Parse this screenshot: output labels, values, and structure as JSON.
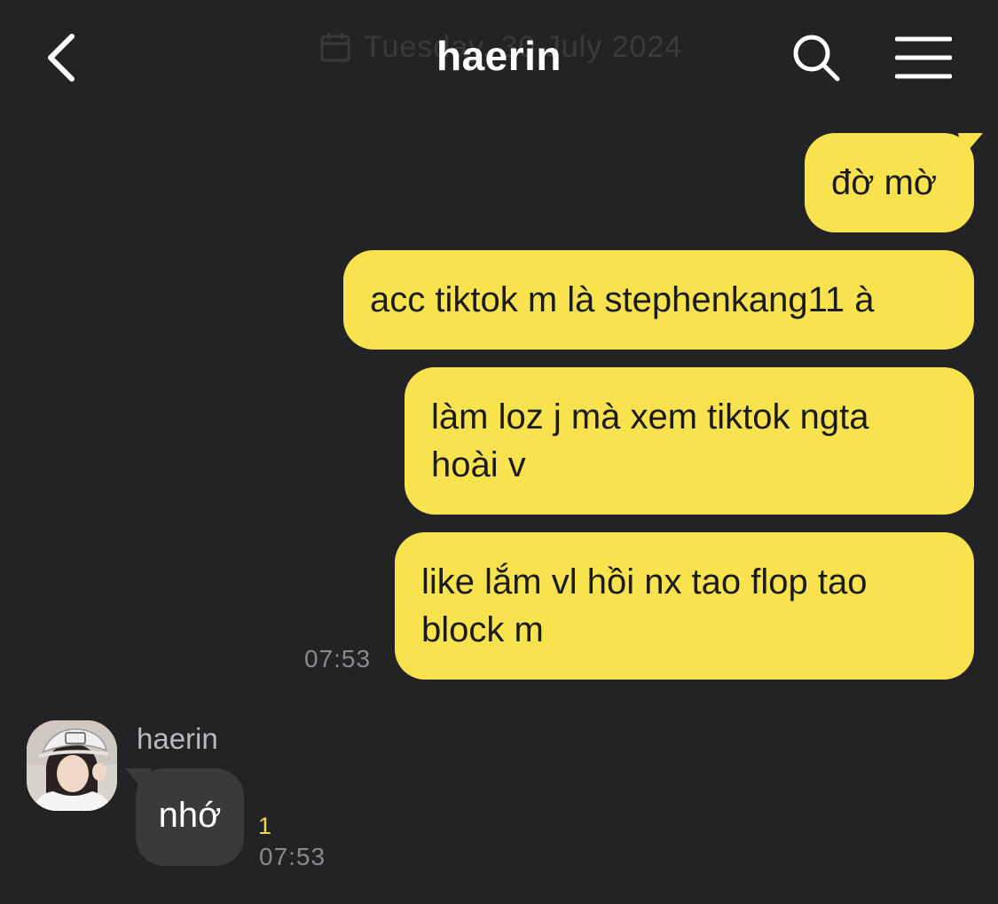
{
  "header": {
    "title": "haerin",
    "date_label": "Tuesday, 30 July 2024",
    "back_icon": "chevron-left-icon",
    "search_icon": "search-icon",
    "menu_icon": "hamburger-menu-icon"
  },
  "outgoing": {
    "messages": [
      {
        "lines": [
          "đờ mờ"
        ]
      },
      {
        "lines": [
          "acc tiktok m là stephenkang11 à"
        ]
      },
      {
        "lines": [
          "làm loz j mà xem tiktok ngta",
          "hoài v"
        ]
      },
      {
        "lines": [
          "like lắm vl hồi nx tao flop tao",
          "block m"
        ]
      }
    ],
    "time": "07:53",
    "bubble_color": "#f8e34e"
  },
  "incoming": {
    "sender": "haerin",
    "message": "nhớ",
    "unread_count": "1",
    "time": "07:53",
    "bubble_color": "#3a3a3c"
  }
}
